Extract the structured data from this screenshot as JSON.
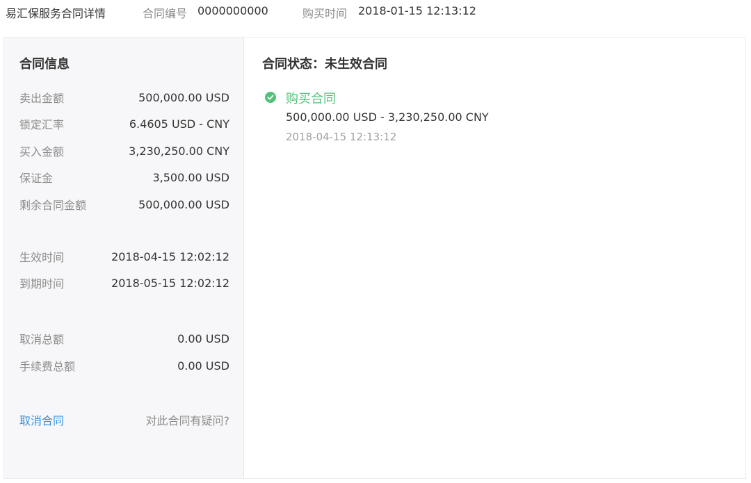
{
  "header": {
    "title": "易汇保服务合同详情",
    "contract_no_label": "合同编号",
    "contract_no": "0000000000",
    "purchase_time_label": "购买时间",
    "purchase_time": "2018-01-15 12:13:12"
  },
  "info": {
    "heading": "合同信息",
    "rows": [
      {
        "label": "卖出金额",
        "value": "500,000.00 USD"
      },
      {
        "label": "锁定汇率",
        "value": "6.4605 USD - CNY"
      },
      {
        "label": "买入金额",
        "value": "3,230,250.00 CNY"
      },
      {
        "label": "保证金",
        "value": "3,500.00 USD"
      },
      {
        "label": "剩余合同金额",
        "value": "500,000.00 USD"
      },
      {
        "label": "生效时间",
        "value": "2018-04-15 12:02:12"
      },
      {
        "label": "到期时间",
        "value": "2018-05-15 12:02:12"
      },
      {
        "label": "取消总额",
        "value": "0.00 USD"
      },
      {
        "label": "手续费总额",
        "value": "0.00 USD"
      }
    ],
    "cancel_label": "取消合同",
    "question_label": "对此合同有疑问?"
  },
  "status": {
    "title": "合同状态：未生效合同",
    "event": {
      "icon": "check-circle-icon",
      "title": "购买合同",
      "detail": "500,000.00 USD - 3,230,250.00 CNY",
      "time": "2018-04-15 12:13:12"
    }
  },
  "colors": {
    "accent_green": "#52c17a",
    "link_blue": "#3a8fd6",
    "panel_bg": "#f7f7f9"
  }
}
